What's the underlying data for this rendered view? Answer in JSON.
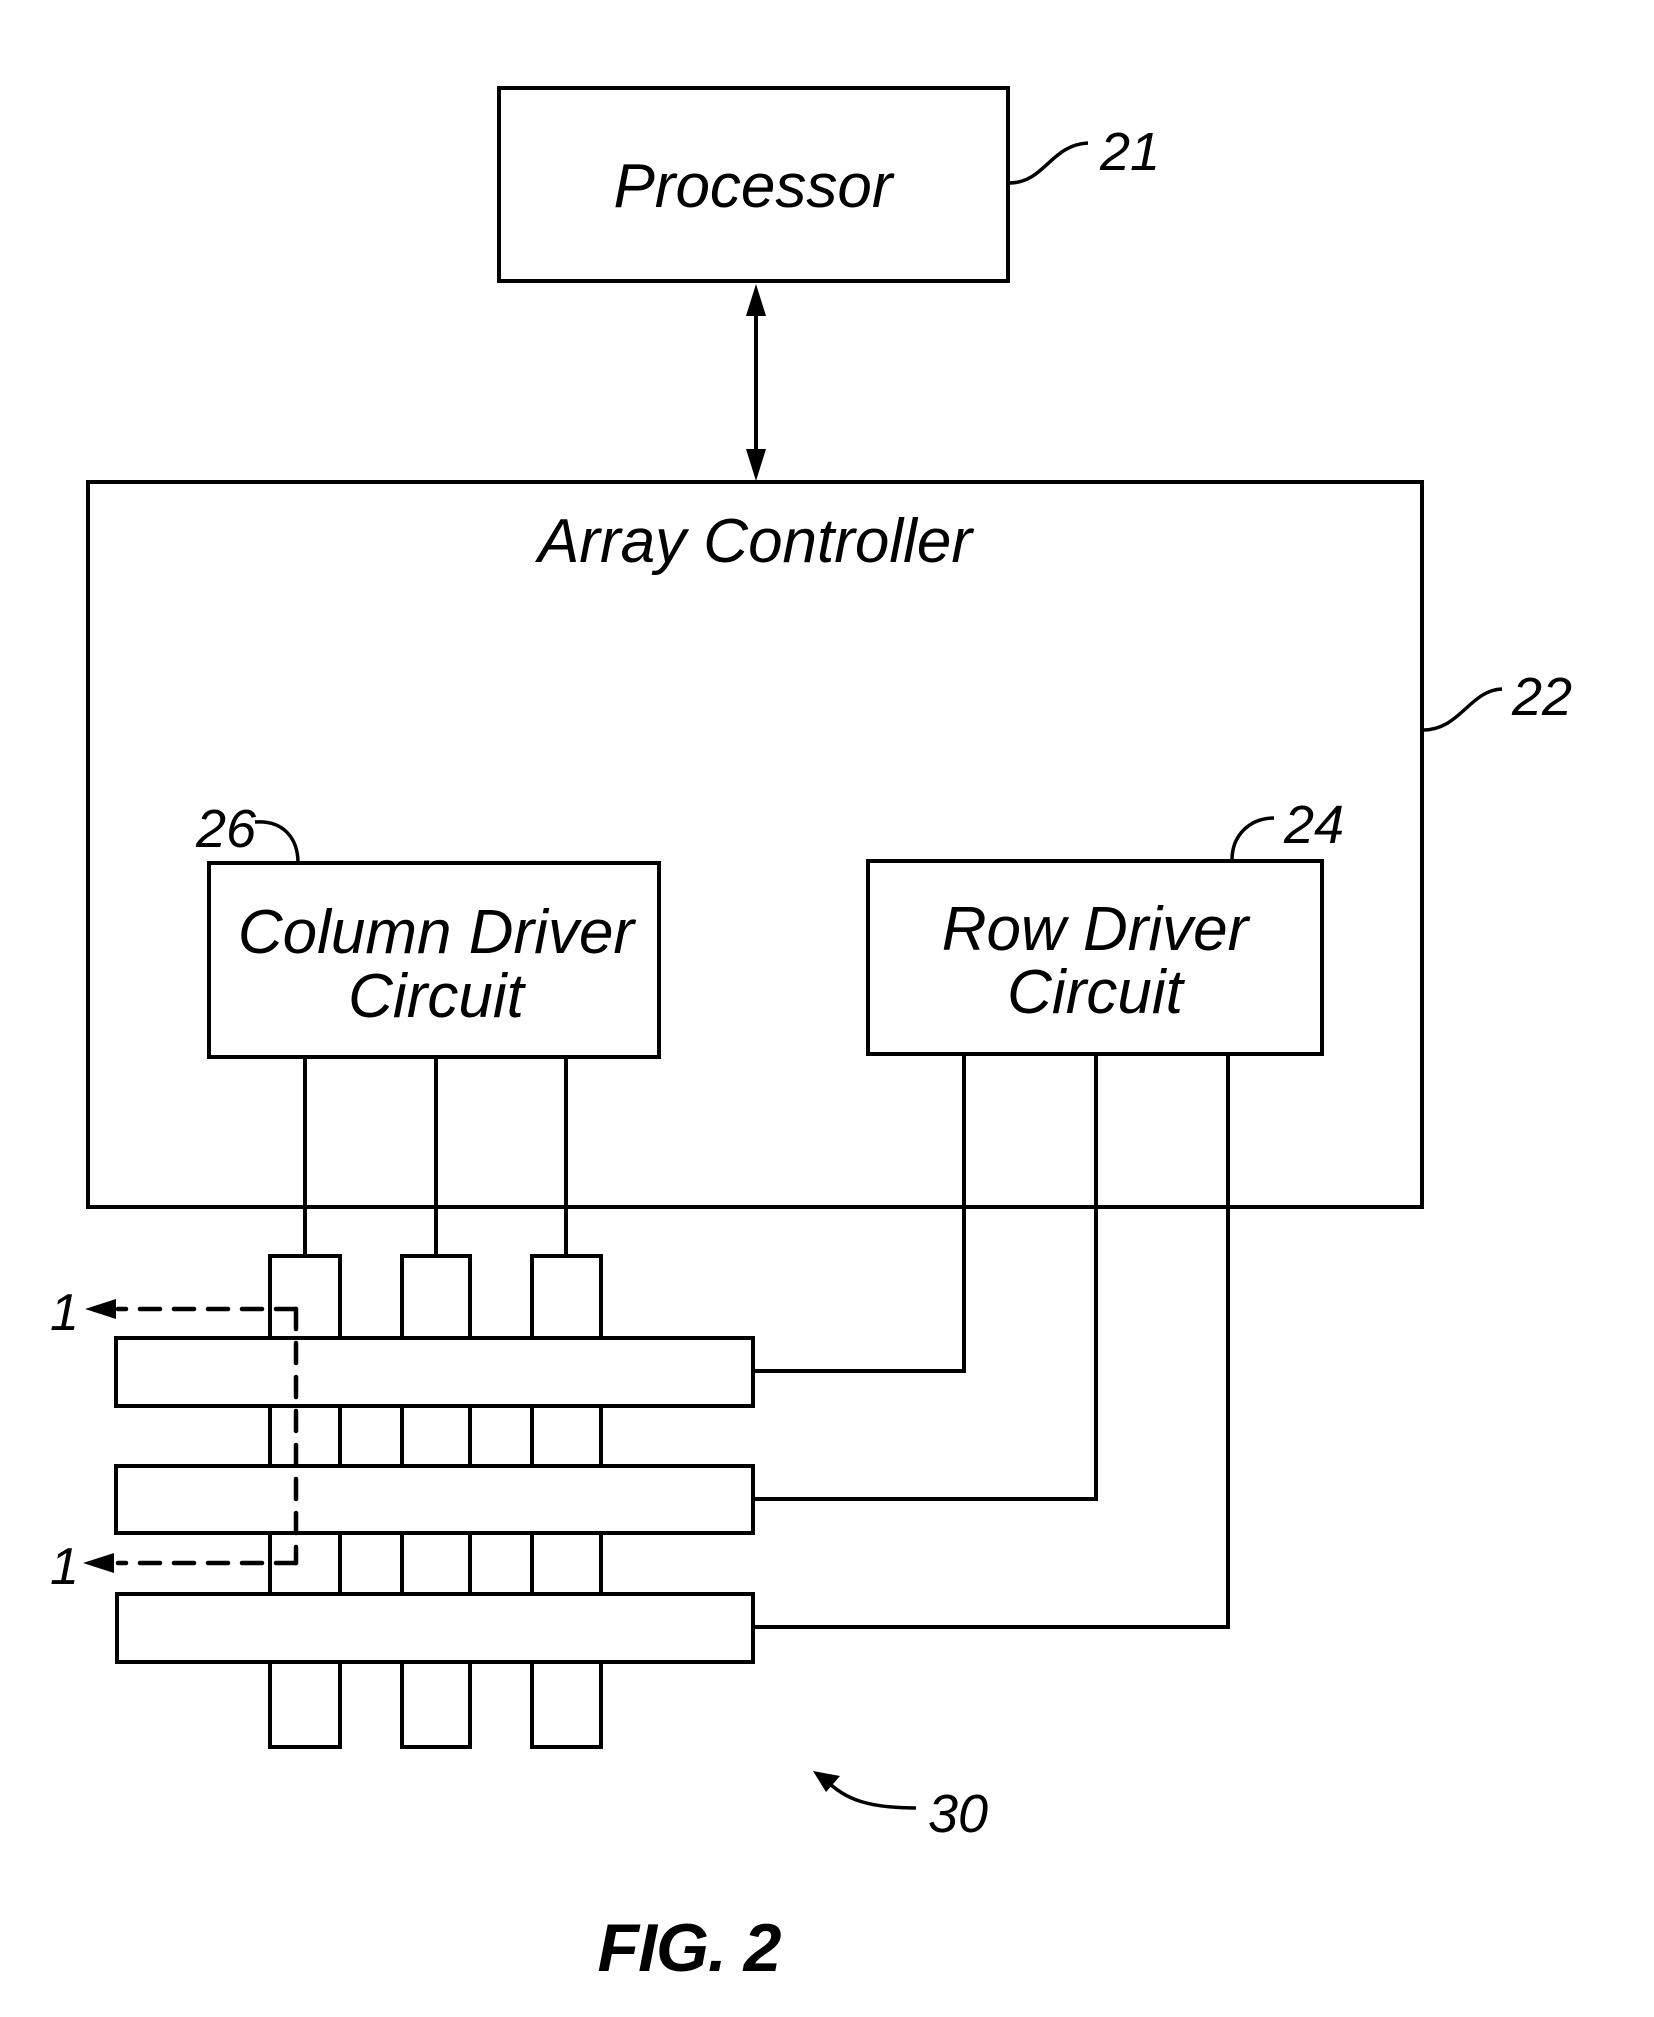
{
  "figure": {
    "caption": "FIG. 2",
    "colors": {
      "ink": "#000000",
      "paper": "#ffffff"
    }
  },
  "blocks": {
    "processor": {
      "label": "Processor",
      "ref": "21"
    },
    "array_controller": {
      "label": "Array Controller",
      "ref": "22"
    },
    "column_driver": {
      "label_line1": "Column Driver",
      "label_line2": "Circuit",
      "ref": "26"
    },
    "row_driver": {
      "label_line1": "Row Driver",
      "label_line2": "Circuit",
      "ref": "24"
    }
  },
  "array": {
    "ref": "30",
    "column_electrode_count": 3,
    "row_electrode_count": 3
  },
  "section_markers": {
    "top_label": "1",
    "bottom_label": "1"
  },
  "connections": [
    {
      "from": "processor",
      "to": "array_controller",
      "type": "bidirectional"
    },
    {
      "from": "column_driver",
      "to": "column_electrodes",
      "count": 3
    },
    {
      "from": "row_driver",
      "to": "row_electrodes",
      "count": 3
    }
  ]
}
